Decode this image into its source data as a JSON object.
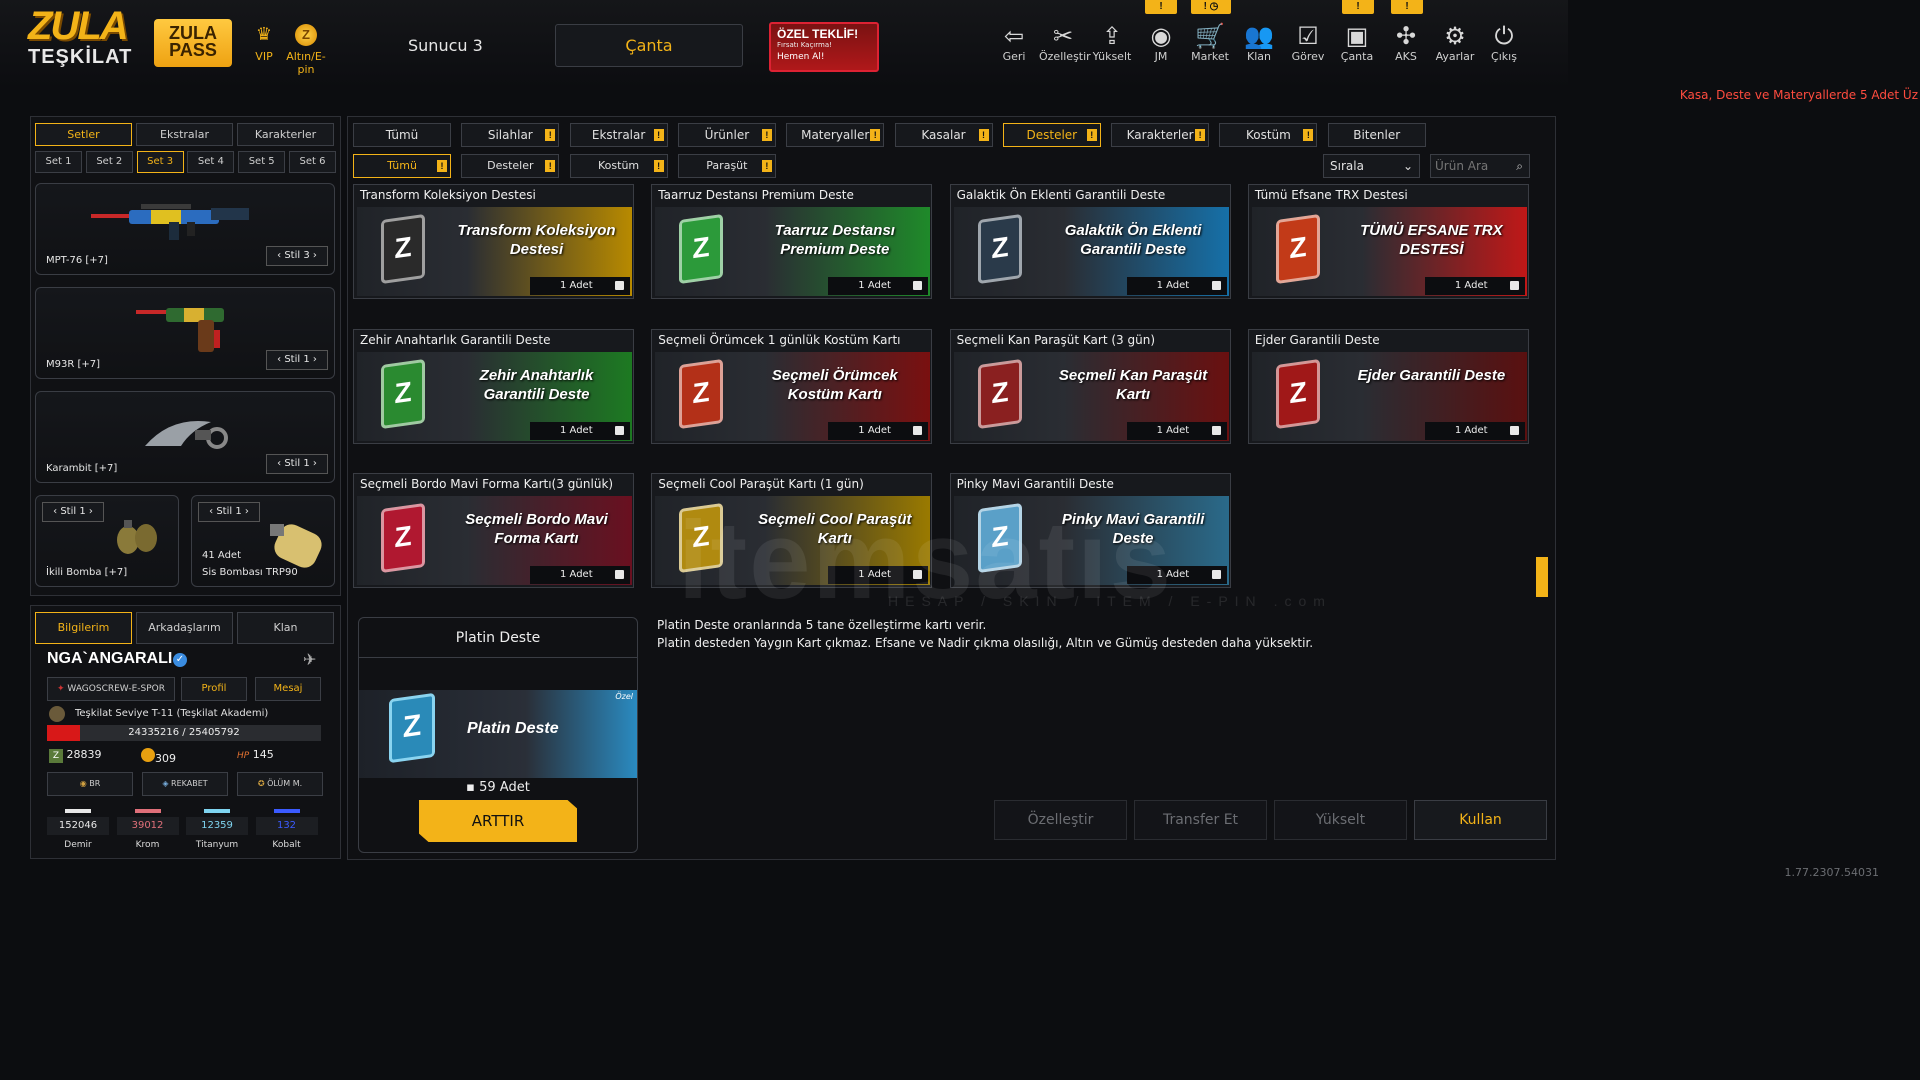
{
  "brand": {
    "logo_top": "ZULA",
    "logo_bottom": "TEŞKİLAT",
    "pass_top": "ZULA",
    "pass_bottom": "PASS",
    "vip": "VIP",
    "gold": "Altın/E-pin"
  },
  "server": "Sunucu 3",
  "canta_button": "Çanta",
  "offer": {
    "title": "ÖZEL TEKLİF!",
    "sub": "Fırsatı Kaçırma!",
    "cta": "Hemen Al!"
  },
  "nav": [
    {
      "label": "Geri",
      "icon": "back-icon",
      "glyph": "⇦"
    },
    {
      "label": "Özelleştir",
      "icon": "tools-icon",
      "glyph": "✂"
    },
    {
      "label": "Yükselt",
      "icon": "upgrade-icon",
      "glyph": "⇪"
    },
    {
      "label": "JM",
      "icon": "coins-icon",
      "glyph": "◉"
    },
    {
      "label": "Market",
      "icon": "cart-icon",
      "glyph": "🛒"
    },
    {
      "label": "Klan",
      "icon": "clan-icon",
      "glyph": "👥"
    },
    {
      "label": "Görev",
      "icon": "task-icon",
      "glyph": "☑"
    },
    {
      "label": "Çanta",
      "icon": "bag-icon",
      "glyph": "▣"
    },
    {
      "label": "AKS",
      "icon": "aks-icon",
      "glyph": "✣"
    },
    {
      "label": "Ayarlar",
      "icon": "gear-icon",
      "glyph": "⚙"
    },
    {
      "label": "Çıkış",
      "icon": "power-icon",
      "glyph": "⏻"
    }
  ],
  "nav_badges": [
    "!",
    "! ◷",
    "!",
    "!"
  ],
  "notice": "Kasa, Deste ve Materyallerde 5 Adet Üz",
  "left": {
    "tabs": [
      "Setler",
      "Ekstralar",
      "Karakterler"
    ],
    "sets": [
      "Set 1",
      "Set 2",
      "Set 3",
      "Set 4",
      "Set 5",
      "Set 6"
    ],
    "weapons": [
      {
        "name": "MPT-76 [+7]",
        "stil": "Stil 3"
      },
      {
        "name": "M93R [+7]",
        "stil": "Stil 1"
      },
      {
        "name": "Karambit [+7]",
        "stil": "Stil 1"
      }
    ],
    "small": [
      {
        "name": "İkili Bomba [+7]",
        "stil": "Stil 1",
        "count": ""
      },
      {
        "name": "Sis Bombası TRP90",
        "stil": "Stil 1",
        "count": "41 Adet"
      }
    ]
  },
  "profile": {
    "tabs": [
      "Bilgilerim",
      "Arkadaşlarım",
      "Klan"
    ],
    "name": "NGA`ANGARALI",
    "clan": "WAGOSCREW-E-SPOR",
    "btn_profile": "Profil",
    "btn_msg": "Mesaj",
    "level": "Teşkilat Seviye T-11 (Teşkilat Akademi)",
    "xp": "24335216 / 25405792",
    "xp_progress": 0.12,
    "stats": [
      "28839",
      "309",
      "145"
    ],
    "modes": [
      "BR",
      "REKABET",
      "ÖLÜM M."
    ],
    "materials": [
      {
        "value": "152046",
        "label": "Demir",
        "color": "#e8e8e8"
      },
      {
        "value": "39012",
        "label": "Krom",
        "color": "#e0707a"
      },
      {
        "value": "12359",
        "label": "Titanyum",
        "color": "#7fd4f0"
      },
      {
        "value": "132",
        "label": "Kobalt",
        "color": "#3b5bff"
      }
    ]
  },
  "tabs1": [
    {
      "label": "Tümü",
      "badge": false,
      "active": false
    },
    {
      "label": "Silahlar",
      "badge": true,
      "active": false
    },
    {
      "label": "Ekstralar",
      "badge": true,
      "active": false
    },
    {
      "label": "Ürünler",
      "badge": true,
      "active": false
    },
    {
      "label": "Materyaller",
      "badge": true,
      "active": false
    },
    {
      "label": "Kasalar",
      "badge": true,
      "active": false
    },
    {
      "label": "Desteler",
      "badge": true,
      "active": true
    },
    {
      "label": "Karakterler",
      "badge": true,
      "active": false
    },
    {
      "label": "Kostüm",
      "badge": true,
      "active": false
    },
    {
      "label": "Bitenler",
      "badge": false,
      "active": false
    }
  ],
  "tabs2": [
    {
      "label": "Tümü",
      "badge": true,
      "active": true
    },
    {
      "label": "Desteler",
      "badge": true,
      "active": false
    },
    {
      "label": "Kostüm",
      "badge": true,
      "active": false
    },
    {
      "label": "Paraşüt",
      "badge": true,
      "active": false
    }
  ],
  "sort": "Sırala",
  "search_placeholder": "Ürün Ara",
  "cards": [
    {
      "title": "Transform Koleksiyon Destesi",
      "art": "Transform Koleksiyon Destesi",
      "adet": "1 Adet",
      "bg": "#b88a00",
      "book": "#2a2a2a"
    },
    {
      "title": "Taarruz Destansı Premium Deste",
      "art": "Taarruz Destansı Premium Deste",
      "adet": "1 Adet",
      "bg": "#1f8a2a",
      "book": "#2c9a3a"
    },
    {
      "title": "Galaktik Ön Eklenti Garantili Deste",
      "art": "Galaktik Ön Eklenti Garantili Deste",
      "adet": "1 Adet",
      "bg": "#1670a8",
      "book": "#2a3a4a"
    },
    {
      "title": "Tümü Efsane TRX Destesi",
      "art": "TÜMÜ EFSANE TRX DESTESİ",
      "adet": "1 Adet",
      "bg": "#c01818",
      "book": "#c23a18"
    },
    {
      "title": "Zehir Anahtarlık Garantili Deste",
      "art": "Zehir Anahtarlık Garantili Deste",
      "adet": "1 Adet",
      "bg": "#1d7a22",
      "book": "#2a8a30"
    },
    {
      "title": "Seçmeli Örümcek 1 günlük Kostüm Kartı",
      "art": "Seçmeli Örümcek Kostüm Kartı",
      "adet": "1 Adet",
      "bg": "#7a1010",
      "book": "#b33018"
    },
    {
      "title": "Seçmeli Kan Paraşüt Kart (3 gün)",
      "art": "Seçmeli Kan Paraşüt Kartı",
      "adet": "1 Adet",
      "bg": "#6a1010",
      "book": "#8a2020"
    },
    {
      "title": "Ejder Garantili Deste",
      "art": "Ejder Garantili Deste",
      "adet": "1 Adet",
      "bg": "#5a1010",
      "book": "#a01818"
    },
    {
      "title": "Seçmeli Bordo Mavi Forma Kartı(3 günlük)",
      "art": "Seçmeli Bordo Mavi Forma Kartı",
      "adet": "1 Adet",
      "bg": "#6a1020",
      "book": "#b01830"
    },
    {
      "title": "Seçmeli Cool Paraşüt Kartı (1 gün)",
      "art": "Seçmeli Cool Paraşüt Kartı",
      "adet": "1 Adet",
      "bg": "#9a7a00",
      "book": "#b08a10"
    },
    {
      "title": "Pinky Mavi Garantili Deste",
      "art": "Pinky Mavi Garantili Deste",
      "adet": "1 Adet",
      "bg": "#2a6a8a",
      "book": "#5aa0c8"
    }
  ],
  "detail": {
    "name": "Platin Deste",
    "art": "Platin Deste",
    "badge": "Özel",
    "count": "59 Adet",
    "button": "ARTTIR",
    "desc1": "Platin Deste oranlarında 5 tane özelleştirme kartı verir.",
    "desc2": "Platin desteden Yaygın Kart çıkmaz. Efsane ve Nadir çıkma olasılığı, Altın ve Gümüş desteden daha yüksektir."
  },
  "actions": [
    "Özelleştir",
    "Transfer Et",
    "Yükselt",
    "Kullan"
  ],
  "watermark": "itemsatis",
  "watermark_sub": "HESAP / SKIN / ITEM / E-PIN",
  "watermark_dom": ".com",
  "version": "1.77.2307.54031"
}
